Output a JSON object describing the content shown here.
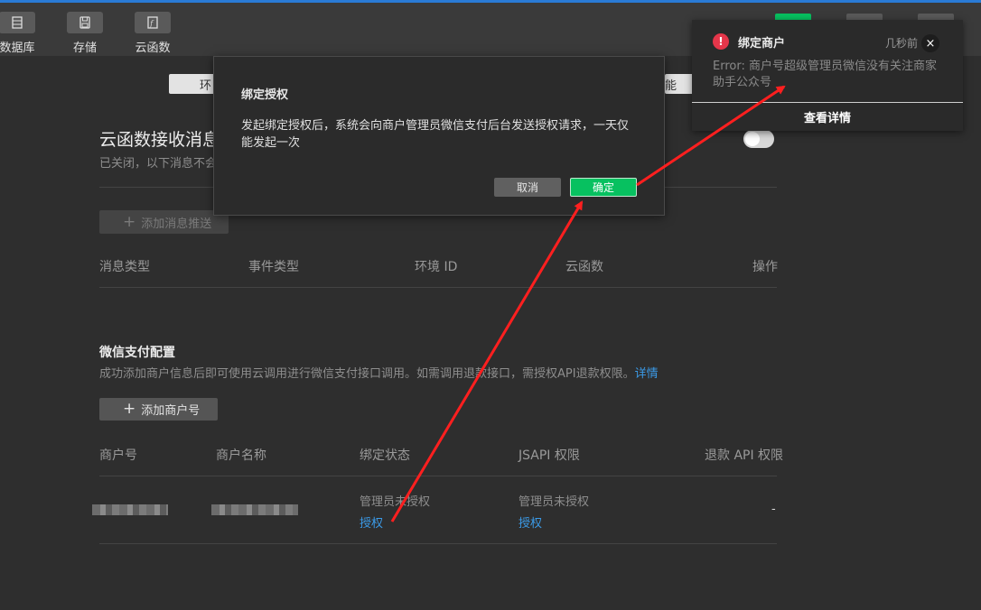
{
  "toolbar": {
    "items": [
      {
        "label": "数据库",
        "icon": "database-icon"
      },
      {
        "label": "存储",
        "icon": "storage-icon"
      },
      {
        "label": "云函数",
        "icon": "cloud-function-icon"
      }
    ]
  },
  "env_tab": {
    "label_left": "环",
    "label_right": "能"
  },
  "section": {
    "title": "云函数接收消息推送",
    "desc": "已关闭，以下消息不会"
  },
  "push": {
    "add_label": "添加消息推送",
    "columns": [
      "消息类型",
      "事件类型",
      "环境 ID",
      "云函数",
      "操作"
    ]
  },
  "pay": {
    "title": "微信支付配置",
    "desc": "成功添加商户信息后即可使用云调用进行微信支付接口调用。如需调用退款接口，需授权API退款权限。",
    "desc_link": "详情",
    "add_label": "添加商户号",
    "columns": [
      "商户号",
      "商户名称",
      "绑定状态",
      "JSAPI 权限",
      "退款 API 权限"
    ],
    "row": {
      "bind_status": "管理员未授权",
      "bind_action": "授权",
      "jsapi_status": "管理员未授权",
      "jsapi_action": "授权",
      "refund": "-"
    }
  },
  "modal": {
    "title": "绑定授权",
    "body": "发起绑定授权后，系统会向商户管理员微信支付后台发送授权请求，一天仅能发起一次",
    "cancel": "取消",
    "ok": "确定"
  },
  "toast": {
    "title": "绑定商户",
    "time": "几秒前",
    "message": "Error: 商户号超级管理员微信没有关注商家助手公众号",
    "action": "查看详情",
    "icon_mark": "!",
    "close_mark": "×"
  },
  "colors": {
    "accent_green": "#07c160",
    "link_blue": "#3b9be8",
    "error_red": "#e5364a",
    "arrow_red": "#ff1f1f"
  }
}
